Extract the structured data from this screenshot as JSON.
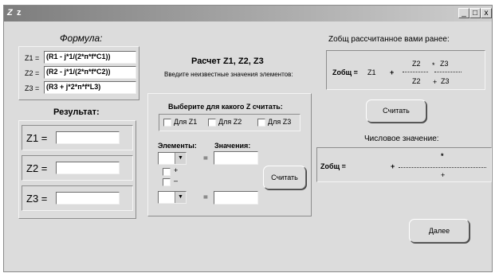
{
  "window": {
    "title": "z",
    "icon": "Z",
    "minimize": "_",
    "maximize": "□",
    "close": "x"
  },
  "formula": {
    "heading": "Формула:",
    "rows": [
      {
        "label": "Z1 =",
        "value": "(R1 - j*1/(2*п*f*C1))"
      },
      {
        "label": "Z2 =",
        "value": "(R2 - j*1/(2*п*f*C2))"
      },
      {
        "label": "Z3 =",
        "value": "(R3 + j*2*п*f*L3)"
      }
    ]
  },
  "result": {
    "heading": "Результат:",
    "rows": [
      {
        "label": "Z1 =",
        "value": ""
      },
      {
        "label": "Z2 =",
        "value": ""
      },
      {
        "label": "Z3 =",
        "value": ""
      }
    ]
  },
  "calc": {
    "heading": "Расчет Z1, Z2, Z3",
    "subheading": "Введите неизвестные значения элементов:",
    "group_title": "Выберите для какого  Z  считать:",
    "checks": [
      {
        "label": "Для Z1",
        "checked": false
      },
      {
        "label": "Для Z2",
        "checked": false
      },
      {
        "label": "Для Z3",
        "checked": false
      }
    ],
    "elements_label": "Элементы:",
    "values_label": "Значения:",
    "eq1": "=",
    "eq2": "=",
    "plus_label": "+",
    "minus_label": "–",
    "calc_button": "Считать"
  },
  "zobsh": {
    "heading": "Zобщ рассчитанное вами ранее:",
    "lhs": "Zобщ =",
    "z1": "Z1",
    "plus": "+",
    "z2_num": "Z2",
    "times": "*",
    "z3_num": "Z3",
    "z2_den": "Z2",
    "plus2": "+",
    "z3_den": "Z3",
    "calc_button": "Считать"
  },
  "numeric": {
    "heading": "Числовое значение:",
    "lhs": "Zобщ =",
    "plus": "+",
    "times": "*",
    "plus2": "+"
  },
  "next_button": "Далее"
}
